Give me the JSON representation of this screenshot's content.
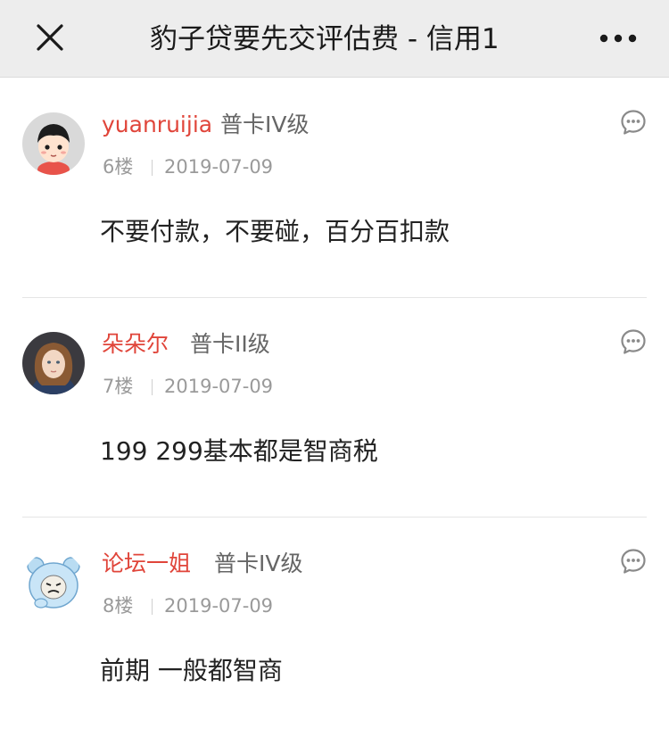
{
  "header": {
    "title": "豹子贷要先交评估费 - 信用1",
    "close_icon": "close-icon",
    "more_icon": "more-dots-icon"
  },
  "comments": [
    {
      "username": "yuanruijia",
      "level": "普卡IV级",
      "floor": "6楼",
      "date": "2019-07-09",
      "content": "不要付款，不要碰，百分百扣款",
      "avatar_icon": "cartoon-kid-avatar-icon"
    },
    {
      "username": "朵朵尔",
      "level": "普卡II级",
      "floor": "7楼",
      "date": "2019-07-09",
      "content": "199 299基本都是智商税",
      "avatar_icon": "girl-photo-avatar-icon"
    },
    {
      "username": "论坛一姐",
      "level": "普卡IV级",
      "floor": "8楼",
      "date": "2019-07-09",
      "content": "前期 一般都智商",
      "avatar_icon": "blue-bear-meme-avatar-icon"
    }
  ],
  "colors": {
    "username": "#e0453a",
    "topbar_bg": "#ededed",
    "meta_text": "#9a9a9a"
  }
}
